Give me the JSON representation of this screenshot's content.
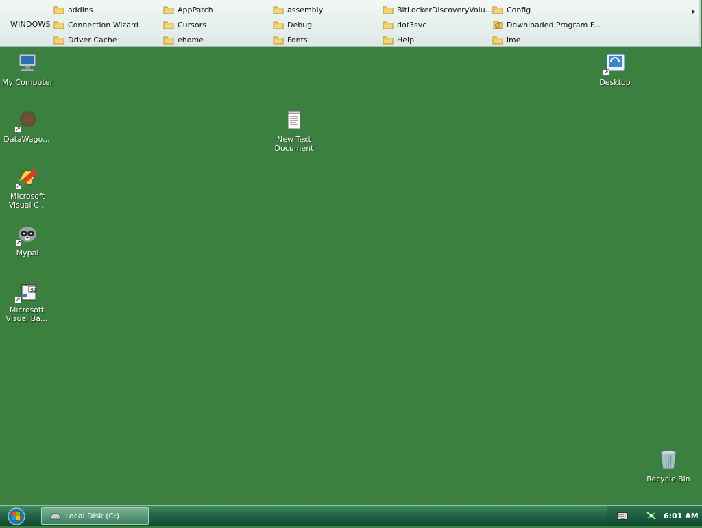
{
  "toolbar": {
    "title": "WINDOWS",
    "items": [
      {
        "label": "addins",
        "icon": "folder-icon"
      },
      {
        "label": "AppPatch",
        "icon": "folder-icon"
      },
      {
        "label": "assembly",
        "icon": "folder-icon"
      },
      {
        "label": "BitLockerDiscoveryVolu...",
        "icon": "folder-icon"
      },
      {
        "label": "Config",
        "icon": "folder-icon"
      },
      {
        "label": "Connection Wizard",
        "icon": "folder-icon"
      },
      {
        "label": "Cursors",
        "icon": "folder-icon"
      },
      {
        "label": "Debug",
        "icon": "folder-icon"
      },
      {
        "label": "dot3svc",
        "icon": "folder-icon"
      },
      {
        "label": "Downloaded Program F...",
        "icon": "special-folder-icon"
      },
      {
        "label": "Driver Cache",
        "icon": "folder-icon"
      },
      {
        "label": "ehome",
        "icon": "folder-icon"
      },
      {
        "label": "Fonts",
        "icon": "folder-icon"
      },
      {
        "label": "Help",
        "icon": "folder-icon"
      },
      {
        "label": "ime",
        "icon": "folder-icon"
      }
    ]
  },
  "desktop": {
    "icons": {
      "my_computer": "My Computer",
      "datawagon": "DataWago...",
      "ms_visual_c": "Microsoft Visual C...",
      "mypal": "Mypal",
      "ms_visual_ba": "Microsoft Visual Ba...",
      "new_text_doc": "New Text Document",
      "desktop_shortcut": "Desktop",
      "recycle_bin": "Recycle Bin"
    },
    "background_color": "#3c8040"
  },
  "taskbar": {
    "task_button_label": "Local Disk (C:)",
    "clock": "6:01 AM"
  }
}
